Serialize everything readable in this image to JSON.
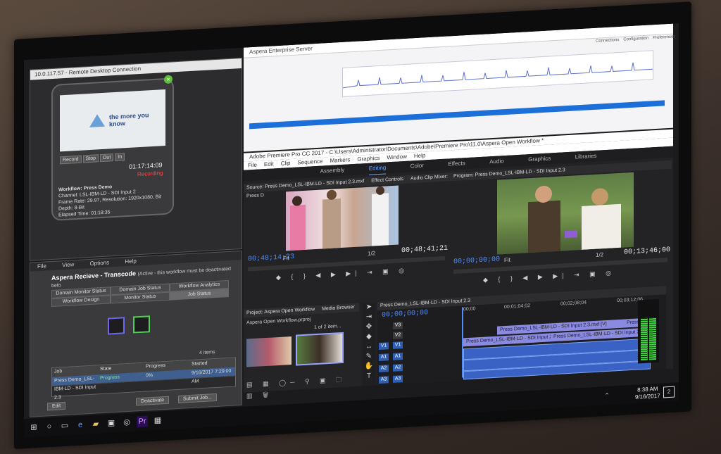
{
  "remote_desktop": {
    "title": "10.0.117.57 - Remote Desktop Connection",
    "preview_text": "the more you know",
    "buttons": [
      "Record",
      "Stop",
      "Out",
      "In"
    ],
    "timecode": "01:17:14:09",
    "status": "Recording",
    "workflow": "Workflow: Press Demo",
    "channel": "Channel: LSL-IBM-LD - SDI Input 2",
    "frame_rate": "Frame Rate: 29.97, Resolution: 1920x1080, Bit Depth: 8-Bit",
    "elapsed": "Elapsed Time: 01:18:35"
  },
  "aspera_transcode": {
    "menu": [
      "File",
      "View",
      "Options",
      "Help"
    ],
    "title": "Aspera Recieve - Transcode",
    "title_note": "(Active - this workflow must be deactivated befo",
    "tabs_top": [
      "Domain Monitor Status",
      "Domain Job Status",
      "Workflow Analytics"
    ],
    "tabs_bottom": [
      "Workflow Design",
      "Monitor Status",
      "Job Status"
    ],
    "items_count": "4 items",
    "grid_headers": [
      "Job",
      "State",
      "Progress",
      "Started"
    ],
    "grid_row": [
      "Press Demo_LSL-IBM-LD - SDI Input 2.3",
      "Progress",
      "0%",
      "9/16/2017 7:29:00 AM"
    ],
    "buttons": [
      "Edit",
      "Deactivate",
      "Submit Job..."
    ]
  },
  "aspera_enterprise": {
    "title": "Aspera Enterprise Server",
    "right_tools": [
      "Connections",
      "Configuration",
      "Preferences"
    ]
  },
  "premiere": {
    "title": "Adobe Premiere Pro CC 2017 - C:\\Users\\Administrator\\Documents\\Adobe\\Premiere Pro\\11.0\\Aspera Open Workflow *",
    "menu": [
      "File",
      "Edit",
      "Clip",
      "Sequence",
      "Markers",
      "Graphics",
      "Window",
      "Help"
    ],
    "workspaces": [
      "Assembly",
      "Editing",
      "Color",
      "Effects",
      "Audio",
      "Graphics",
      "Libraries"
    ],
    "active_workspace": "Editing",
    "source": {
      "tab": "Source: Press Demo_LSL-IBM-LD - SDI Input 2.3.mxf",
      "tab2": "Effect Controls",
      "tab3": "Audio Clip Mixer: Press D",
      "timecode": "00;48;14;23",
      "fit": "Fit",
      "ratio": "1/2",
      "duration": "00;48;41;21"
    },
    "program": {
      "tab": "Program: Press Demo_LSL-IBM-LD - SDI Input 2.3",
      "timecode": "00;00;00;00",
      "fit": "Fit",
      "ratio": "1/2",
      "duration": "00;13;46;00"
    },
    "project": {
      "tab": "Project: Aspera Open Workflow",
      "tab2": "Media Browser",
      "file": "Aspera Open Workflow.prproj",
      "items": "1 of 2 item..."
    },
    "timeline": {
      "tab": "Press Demo_LSL-IBM-LD - SDI Input 2.3",
      "timecode": "00;00;00;00",
      "ruler": [
        ":00;00",
        "00;01;04;02",
        "00;02;08;04",
        "00;03;12;06"
      ],
      "video_tracks": [
        "V3",
        "V2",
        "V1"
      ],
      "audio_tracks": [
        "A1",
        "A2",
        "A3"
      ],
      "clip_v": "Press Demo_LSL-IBM-LD - SDI Input 2.3.mxf [V]",
      "clip_v1": "Press Demo_LSL-IBM-LD - SDI Input 2.3",
      "clip_v1b": "Press Demo_LSL-IBM-LD - SDI Input 2.3",
      "clip_v_tail": "Press"
    }
  },
  "taskbar": {
    "time": "8:38 AM",
    "date": "9/16/2017",
    "notification_count": "2"
  },
  "colors": {
    "accent": "#4f8dff",
    "recording": "#ff4a4a",
    "meter": "#3fd23f"
  }
}
